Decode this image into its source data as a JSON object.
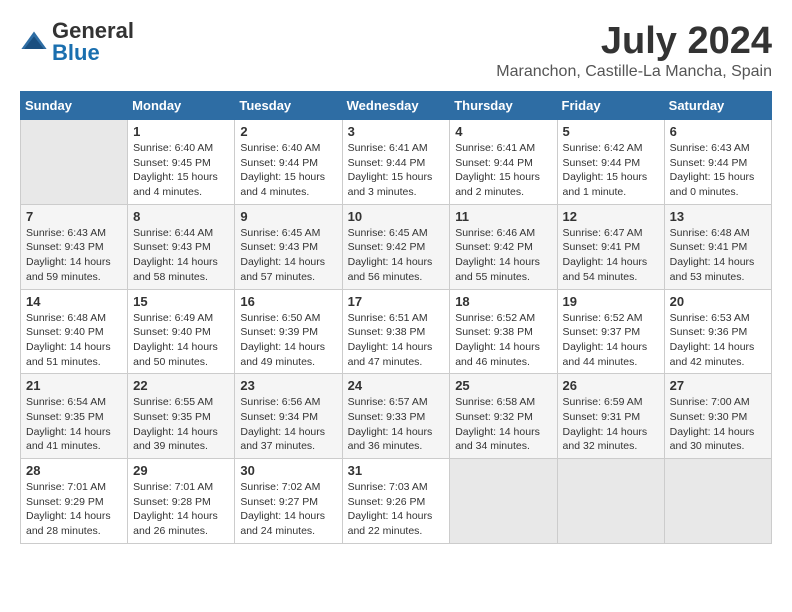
{
  "header": {
    "logo_general": "General",
    "logo_blue": "Blue",
    "month_title": "July 2024",
    "location": "Maranchon, Castille-La Mancha, Spain"
  },
  "calendar": {
    "weekdays": [
      "Sunday",
      "Monday",
      "Tuesday",
      "Wednesday",
      "Thursday",
      "Friday",
      "Saturday"
    ],
    "weeks": [
      [
        {
          "day": "",
          "sunrise": "",
          "sunset": "",
          "daylight": ""
        },
        {
          "day": "1",
          "sunrise": "Sunrise: 6:40 AM",
          "sunset": "Sunset: 9:45 PM",
          "daylight": "Daylight: 15 hours and 4 minutes."
        },
        {
          "day": "2",
          "sunrise": "Sunrise: 6:40 AM",
          "sunset": "Sunset: 9:44 PM",
          "daylight": "Daylight: 15 hours and 4 minutes."
        },
        {
          "day": "3",
          "sunrise": "Sunrise: 6:41 AM",
          "sunset": "Sunset: 9:44 PM",
          "daylight": "Daylight: 15 hours and 3 minutes."
        },
        {
          "day": "4",
          "sunrise": "Sunrise: 6:41 AM",
          "sunset": "Sunset: 9:44 PM",
          "daylight": "Daylight: 15 hours and 2 minutes."
        },
        {
          "day": "5",
          "sunrise": "Sunrise: 6:42 AM",
          "sunset": "Sunset: 9:44 PM",
          "daylight": "Daylight: 15 hours and 1 minute."
        },
        {
          "day": "6",
          "sunrise": "Sunrise: 6:43 AM",
          "sunset": "Sunset: 9:44 PM",
          "daylight": "Daylight: 15 hours and 0 minutes."
        }
      ],
      [
        {
          "day": "7",
          "sunrise": "Sunrise: 6:43 AM",
          "sunset": "Sunset: 9:43 PM",
          "daylight": "Daylight: 14 hours and 59 minutes."
        },
        {
          "day": "8",
          "sunrise": "Sunrise: 6:44 AM",
          "sunset": "Sunset: 9:43 PM",
          "daylight": "Daylight: 14 hours and 58 minutes."
        },
        {
          "day": "9",
          "sunrise": "Sunrise: 6:45 AM",
          "sunset": "Sunset: 9:43 PM",
          "daylight": "Daylight: 14 hours and 57 minutes."
        },
        {
          "day": "10",
          "sunrise": "Sunrise: 6:45 AM",
          "sunset": "Sunset: 9:42 PM",
          "daylight": "Daylight: 14 hours and 56 minutes."
        },
        {
          "day": "11",
          "sunrise": "Sunrise: 6:46 AM",
          "sunset": "Sunset: 9:42 PM",
          "daylight": "Daylight: 14 hours and 55 minutes."
        },
        {
          "day": "12",
          "sunrise": "Sunrise: 6:47 AM",
          "sunset": "Sunset: 9:41 PM",
          "daylight": "Daylight: 14 hours and 54 minutes."
        },
        {
          "day": "13",
          "sunrise": "Sunrise: 6:48 AM",
          "sunset": "Sunset: 9:41 PM",
          "daylight": "Daylight: 14 hours and 53 minutes."
        }
      ],
      [
        {
          "day": "14",
          "sunrise": "Sunrise: 6:48 AM",
          "sunset": "Sunset: 9:40 PM",
          "daylight": "Daylight: 14 hours and 51 minutes."
        },
        {
          "day": "15",
          "sunrise": "Sunrise: 6:49 AM",
          "sunset": "Sunset: 9:40 PM",
          "daylight": "Daylight: 14 hours and 50 minutes."
        },
        {
          "day": "16",
          "sunrise": "Sunrise: 6:50 AM",
          "sunset": "Sunset: 9:39 PM",
          "daylight": "Daylight: 14 hours and 49 minutes."
        },
        {
          "day": "17",
          "sunrise": "Sunrise: 6:51 AM",
          "sunset": "Sunset: 9:38 PM",
          "daylight": "Daylight: 14 hours and 47 minutes."
        },
        {
          "day": "18",
          "sunrise": "Sunrise: 6:52 AM",
          "sunset": "Sunset: 9:38 PM",
          "daylight": "Daylight: 14 hours and 46 minutes."
        },
        {
          "day": "19",
          "sunrise": "Sunrise: 6:52 AM",
          "sunset": "Sunset: 9:37 PM",
          "daylight": "Daylight: 14 hours and 44 minutes."
        },
        {
          "day": "20",
          "sunrise": "Sunrise: 6:53 AM",
          "sunset": "Sunset: 9:36 PM",
          "daylight": "Daylight: 14 hours and 42 minutes."
        }
      ],
      [
        {
          "day": "21",
          "sunrise": "Sunrise: 6:54 AM",
          "sunset": "Sunset: 9:35 PM",
          "daylight": "Daylight: 14 hours and 41 minutes."
        },
        {
          "day": "22",
          "sunrise": "Sunrise: 6:55 AM",
          "sunset": "Sunset: 9:35 PM",
          "daylight": "Daylight: 14 hours and 39 minutes."
        },
        {
          "day": "23",
          "sunrise": "Sunrise: 6:56 AM",
          "sunset": "Sunset: 9:34 PM",
          "daylight": "Daylight: 14 hours and 37 minutes."
        },
        {
          "day": "24",
          "sunrise": "Sunrise: 6:57 AM",
          "sunset": "Sunset: 9:33 PM",
          "daylight": "Daylight: 14 hours and 36 minutes."
        },
        {
          "day": "25",
          "sunrise": "Sunrise: 6:58 AM",
          "sunset": "Sunset: 9:32 PM",
          "daylight": "Daylight: 14 hours and 34 minutes."
        },
        {
          "day": "26",
          "sunrise": "Sunrise: 6:59 AM",
          "sunset": "Sunset: 9:31 PM",
          "daylight": "Daylight: 14 hours and 32 minutes."
        },
        {
          "day": "27",
          "sunrise": "Sunrise: 7:00 AM",
          "sunset": "Sunset: 9:30 PM",
          "daylight": "Daylight: 14 hours and 30 minutes."
        }
      ],
      [
        {
          "day": "28",
          "sunrise": "Sunrise: 7:01 AM",
          "sunset": "Sunset: 9:29 PM",
          "daylight": "Daylight: 14 hours and 28 minutes."
        },
        {
          "day": "29",
          "sunrise": "Sunrise: 7:01 AM",
          "sunset": "Sunset: 9:28 PM",
          "daylight": "Daylight: 14 hours and 26 minutes."
        },
        {
          "day": "30",
          "sunrise": "Sunrise: 7:02 AM",
          "sunset": "Sunset: 9:27 PM",
          "daylight": "Daylight: 14 hours and 24 minutes."
        },
        {
          "day": "31",
          "sunrise": "Sunrise: 7:03 AM",
          "sunset": "Sunset: 9:26 PM",
          "daylight": "Daylight: 14 hours and 22 minutes."
        },
        {
          "day": "",
          "sunrise": "",
          "sunset": "",
          "daylight": ""
        },
        {
          "day": "",
          "sunrise": "",
          "sunset": "",
          "daylight": ""
        },
        {
          "day": "",
          "sunrise": "",
          "sunset": "",
          "daylight": ""
        }
      ]
    ]
  }
}
